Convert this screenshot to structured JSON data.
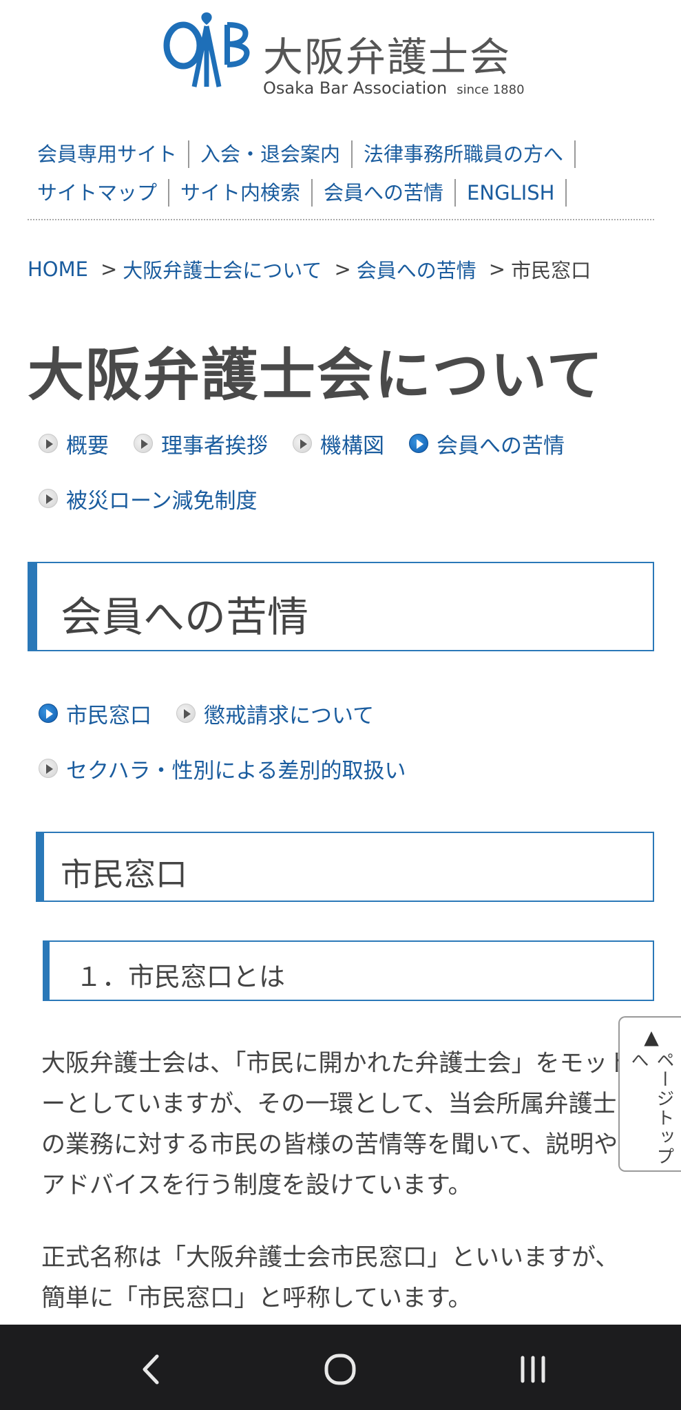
{
  "logo": {
    "name_jp": "大阪弁護士会",
    "name_en": "Osaka Bar Association",
    "since": "since 1880",
    "brand_color": "#1e6fb8"
  },
  "top_nav": {
    "row1": [
      "会員専用サイト",
      "入会・退会案内",
      "法律事務所職員の方へ"
    ],
    "row2": [
      "サイトマップ",
      "サイト内検索",
      "会員への苦情",
      "ENGLISH"
    ]
  },
  "breadcrumb": {
    "items": [
      "HOME",
      "大阪弁護士会について",
      "会員への苦情"
    ],
    "separator": ">",
    "current": "市民窓口"
  },
  "page_title": "大阪弁護士会について",
  "about_nav": {
    "items": [
      {
        "label": "概要",
        "active": false
      },
      {
        "label": "理事者挨拶",
        "active": false
      },
      {
        "label": "機構図",
        "active": false
      },
      {
        "label": "会員への苦情",
        "active": true
      },
      {
        "label": "被災ローン減免制度",
        "active": false
      }
    ]
  },
  "section_heading": "会員への苦情",
  "complaint_nav": {
    "items": [
      {
        "label": "市民窓口",
        "active": true
      },
      {
        "label": "懲戒請求について",
        "active": false
      },
      {
        "label": "セクハラ・性別による差別的取扱い",
        "active": false
      }
    ]
  },
  "sub_heading": "市民窓口",
  "sub_sub_heading": "１．市民窓口とは",
  "paragraphs": [
    "大阪弁護士会は、「市民に開かれた弁護士会」をモットーとしていますが、その一環として、当会所属弁護士の業務に対する市民の皆様の苦情等を聞いて、説明やアドバイスを行う制度を設けています。",
    "正式名称は「大阪弁護士会市民窓口」といいますが、簡単に「市民窓口」と呼称しています。"
  ],
  "page_top": {
    "arrow": "▲",
    "label": "ページトップへ"
  },
  "colors": {
    "link": "#1a5c9e",
    "accent_border": "#2a78b8",
    "system_bar": "#1c1c1e"
  }
}
